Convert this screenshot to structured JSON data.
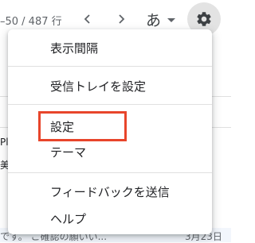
{
  "toolbar": {
    "pager_text": "–50 / 487 行",
    "ime_char": "あ",
    "icons": {
      "prev": "chevron-left-icon",
      "next": "chevron-right-icon",
      "ime_caret": "caret-down-icon",
      "settings": "gear-icon"
    }
  },
  "background": {
    "fragment_pl": "Pl",
    "fragment_bi": "美",
    "bottom_row_text": "です。 ご確認の願いい...",
    "bottom_row_date": "3月23日"
  },
  "menu": {
    "items": [
      {
        "label": "表示間隔"
      },
      {
        "label": "受信トレイを設定"
      },
      {
        "label": "設定",
        "highlighted": true
      },
      {
        "label": "テーマ"
      },
      {
        "label": "フィードバックを送信"
      },
      {
        "label": "ヘルプ"
      }
    ],
    "highlight_color": "#e8452b"
  }
}
